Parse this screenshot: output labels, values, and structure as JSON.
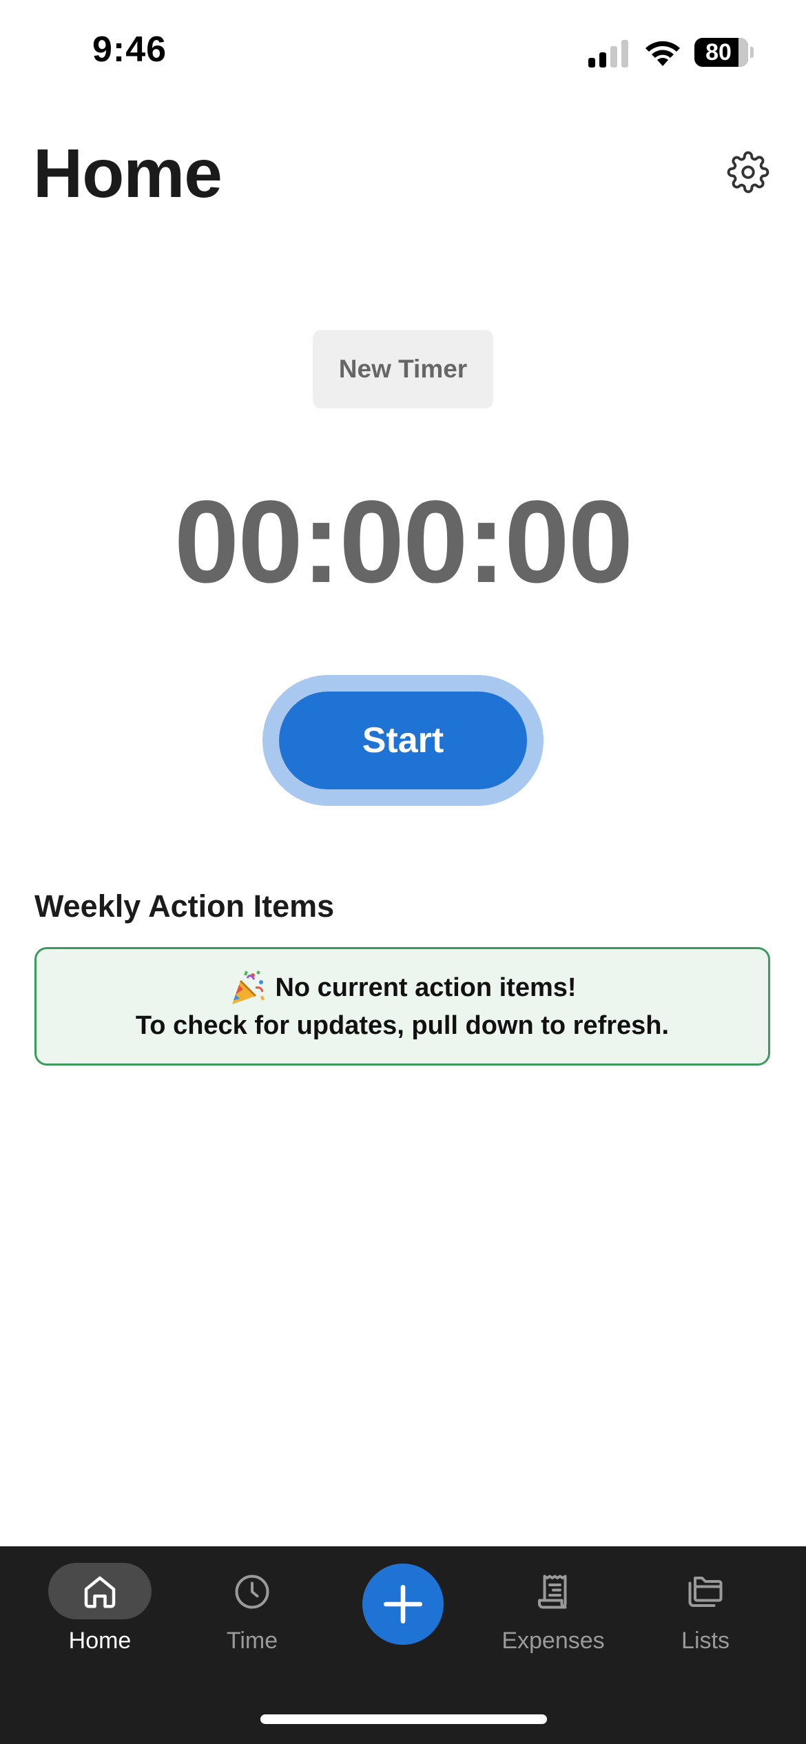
{
  "status_bar": {
    "time": "9:46",
    "battery_level": "80",
    "battery_fraction": 0.8,
    "signal_bars_active": 2,
    "signal_bars_total": 4
  },
  "header": {
    "title": "Home",
    "settings_icon": "gear-icon"
  },
  "timer": {
    "new_timer_label": "New Timer",
    "display": "00:00:00",
    "start_label": "Start"
  },
  "weekly_action_items": {
    "title": "Weekly Action Items",
    "emoji_icon": "party-popper-icon",
    "message": "No current action items!",
    "hint": "To check for updates, pull down to refresh."
  },
  "tab_bar": {
    "items": [
      {
        "label": "Home",
        "icon": "house-icon",
        "active": true
      },
      {
        "label": "Time",
        "icon": "clock-icon",
        "active": false
      },
      {
        "label": "",
        "icon": "plus-icon",
        "active": false
      },
      {
        "label": "Expenses",
        "icon": "receipt-icon",
        "active": false
      },
      {
        "label": "Lists",
        "icon": "folder-icon",
        "active": false
      }
    ]
  },
  "colors": {
    "accent": "#1f73d4",
    "accent_ring": "#a8c8ef",
    "success_border": "#3c9a5e",
    "success_bg": "#ecf6ef",
    "tab_bar_bg": "#1e1e1e"
  }
}
